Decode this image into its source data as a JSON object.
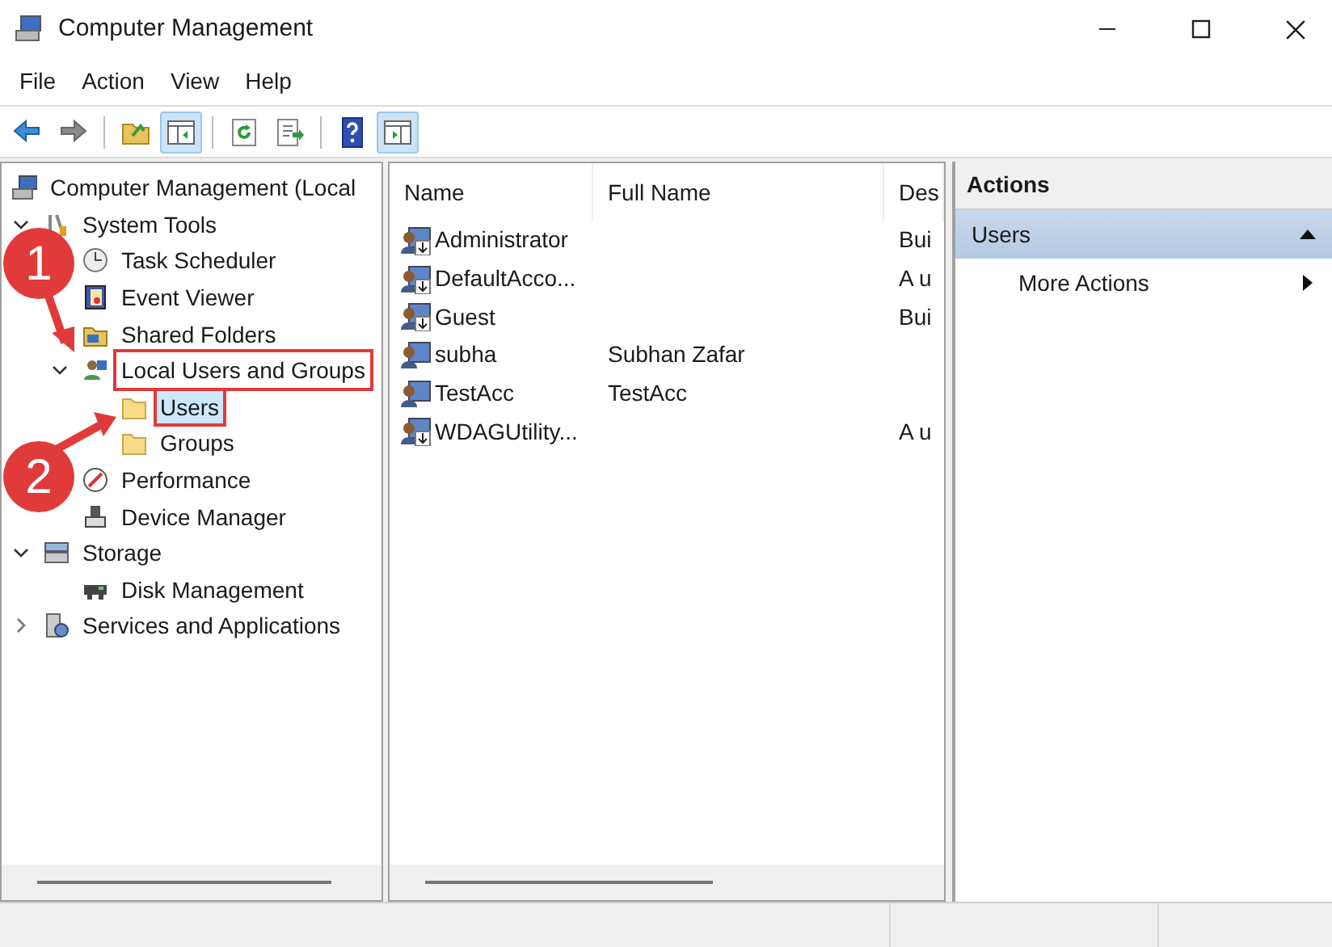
{
  "window": {
    "title": "Computer Management"
  },
  "menu": [
    "File",
    "Action",
    "View",
    "Help"
  ],
  "toolbar": [
    {
      "kind": "back",
      "pressed": false
    },
    {
      "kind": "forward",
      "pressed": false
    },
    {
      "kind": "sep"
    },
    {
      "kind": "up",
      "pressed": false
    },
    {
      "kind": "tree",
      "pressed": true
    },
    {
      "kind": "sep"
    },
    {
      "kind": "refresh",
      "pressed": false
    },
    {
      "kind": "export",
      "pressed": false
    },
    {
      "kind": "sep"
    },
    {
      "kind": "help",
      "pressed": false
    },
    {
      "kind": "actionpane",
      "pressed": true
    }
  ],
  "tree": [
    {
      "label": "Computer Management (Local",
      "kind": "computer",
      "selected": false,
      "highlighted": false,
      "children": [
        {
          "label": "System Tools",
          "kind": "tools",
          "selected": false,
          "highlighted": false,
          "expanded": true,
          "children": [
            {
              "label": "Task Scheduler",
              "kind": "clock",
              "selected": false,
              "highlighted": false
            },
            {
              "label": "Event Viewer",
              "kind": "log",
              "selected": false,
              "highlighted": false
            },
            {
              "label": "Shared Folders",
              "kind": "share",
              "selected": false,
              "highlighted": false
            },
            {
              "label": "Local Users and Groups",
              "kind": "users",
              "selected": false,
              "highlighted": true,
              "expanded": true,
              "children": [
                {
                  "label": "Users",
                  "kind": "folder",
                  "selected": true,
                  "highlighted": true
                },
                {
                  "label": "Groups",
                  "kind": "folder",
                  "selected": false,
                  "highlighted": false
                }
              ]
            },
            {
              "label": "Performance",
              "kind": "gauge",
              "selected": false,
              "highlighted": false
            },
            {
              "label": "Device Manager",
              "kind": "device",
              "selected": false,
              "highlighted": false
            }
          ]
        },
        {
          "label": "Storage",
          "kind": "storage",
          "selected": false,
          "highlighted": false,
          "expanded": true,
          "children": [
            {
              "label": "Disk Management",
              "kind": "disk",
              "selected": false,
              "highlighted": false
            }
          ]
        },
        {
          "label": "Services and Applications",
          "kind": "services",
          "selected": false,
          "highlighted": false,
          "expanded": false
        }
      ]
    }
  ],
  "table": {
    "columns": [
      "Name",
      "Full Name",
      "Des"
    ],
    "rows": [
      {
        "name": "Administrator",
        "description": "Bui",
        "disabled": true
      },
      {
        "name": "DefaultAcco...",
        "description": "A u",
        "disabled": true
      },
      {
        "name": "Guest",
        "description": "Bui",
        "disabled": true
      },
      {
        "name": "subha",
        "full_name": "Subhan Zafar",
        "disabled": false
      },
      {
        "name": "TestAcc",
        "full_name": "TestAcc",
        "disabled": false
      },
      {
        "name": "WDAGUtility...",
        "description": "A u",
        "disabled": true
      }
    ]
  },
  "actions": {
    "title": "Actions",
    "section": {
      "label": "Users",
      "expanded": true
    },
    "items": [
      {
        "label": "More Actions"
      }
    ]
  },
  "annotations": [
    {
      "label": "1"
    },
    {
      "label": "2"
    }
  ]
}
